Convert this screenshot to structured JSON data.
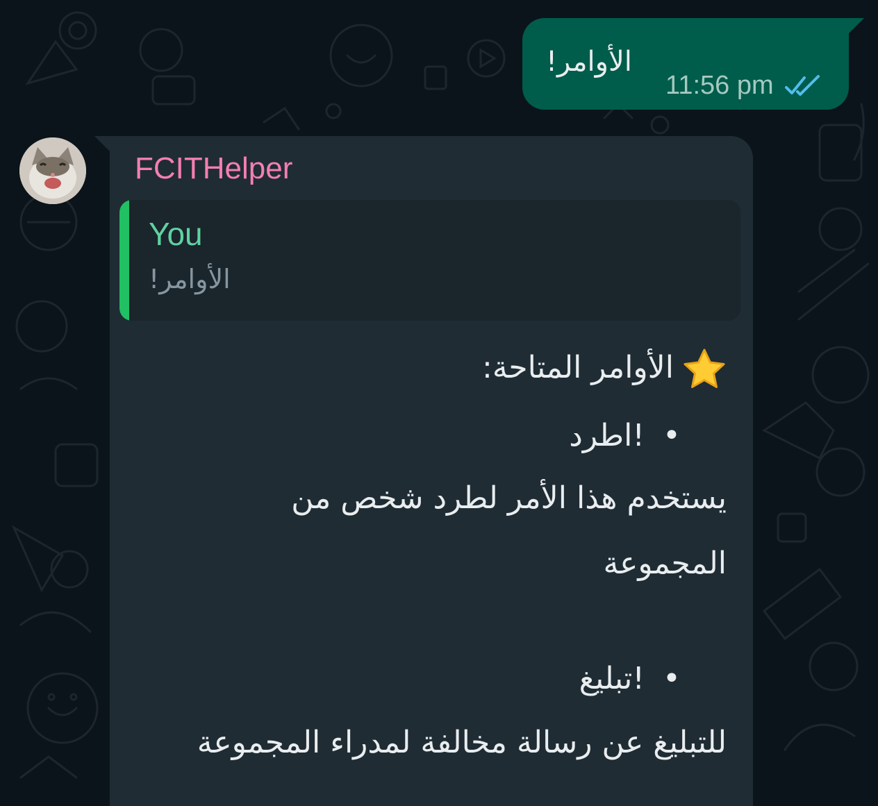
{
  "outgoing": {
    "text": "الأوامر!",
    "time": "11:56 pm",
    "status_icon": "double-check-read-icon"
  },
  "incoming": {
    "sender": "FCITHelper",
    "avatar_icon": "cat-avatar",
    "quote": {
      "author": "You",
      "text": "الأوامر!"
    },
    "lines": {
      "heading": "الأوامر المتاحة:",
      "bullet_char": "•",
      "cmd1": "!اطرد",
      "desc1_line1": "يستخدم هذا الأمر لطرد شخص من",
      "desc1_line2": "المجموعة",
      "cmd2": "!تبليغ",
      "desc2": "للتبليغ عن رسالة مخالفة لمدراء المجموعة"
    }
  },
  "colors": {
    "background": "#0b141a",
    "outgoing_bubble": "#005c4b",
    "incoming_bubble": "#1f2c34",
    "sender_name": "#f47fb0",
    "quote_bar": "#21c063",
    "quote_author": "#5fd2a0",
    "read_ticks": "#53bdeb"
  }
}
